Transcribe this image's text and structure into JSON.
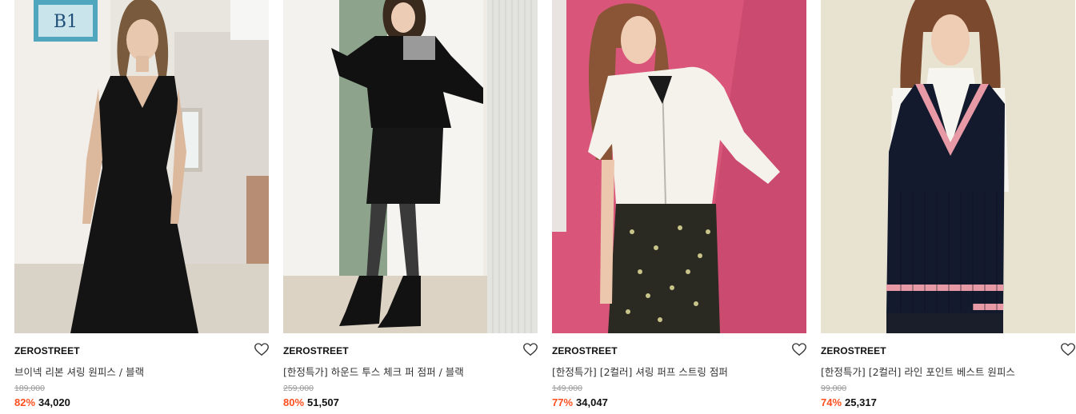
{
  "products": [
    {
      "brand": "ZEROSTREET",
      "name": "브이넥 리본 셔링 원피스 / 블랙",
      "original_price": "189,000",
      "discount": "82%",
      "price": "34,020",
      "image": "model-black-dress-photo"
    },
    {
      "brand": "ZEROSTREET",
      "name": "[한정특가] 하운드 투스 체크 퍼 점퍼 / 블랙",
      "original_price": "259,000",
      "discount": "80%",
      "price": "51,507",
      "image": "model-fur-jumper-photo"
    },
    {
      "brand": "ZEROSTREET",
      "name": "[한정특가] [2컬러] 셔링 퍼프 스트링 점퍼",
      "original_price": "149,000",
      "discount": "77%",
      "price": "34,047",
      "image": "model-puff-jumper-photo"
    },
    {
      "brand": "ZEROSTREET",
      "name": "[한정특가] [2컬러] 라인 포인트 베스트 원피스",
      "original_price": "99,000",
      "discount": "74%",
      "price": "25,317",
      "image": "model-knit-vest-photo"
    }
  ],
  "colors": {
    "discount": "#ff4f1f",
    "price": "#111111",
    "original_price": "#9a9a9a"
  },
  "icons": {
    "wishlist": "heart-outline-icon"
  }
}
